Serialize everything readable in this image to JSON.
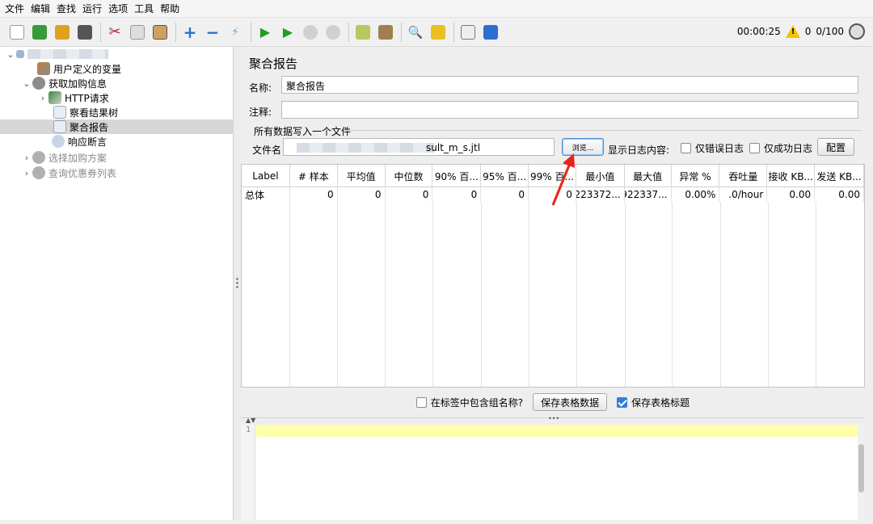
{
  "menu": [
    "文件",
    "编辑",
    "查找",
    "运行",
    "选项",
    "工具",
    "帮助"
  ],
  "toolbar": {
    "timer": "00:00:25",
    "warning_count": "0",
    "thread_count": "0/100",
    "icons": [
      "new-icon",
      "template-icon",
      "open-icon",
      "save-icon",
      "cut-icon",
      "copy-icon",
      "paste-icon",
      "add-icon",
      "remove-icon",
      "toggle-icon",
      "start-icon",
      "start-no-pause-icon",
      "stop-icon",
      "shutdown-icon",
      "clear-icon",
      "clear-all-icon",
      "search-icon",
      "reset-search-icon",
      "function-helper-icon",
      "help-icon"
    ]
  },
  "tree": {
    "items": [
      {
        "label": "",
        "level": 0,
        "expanded": true,
        "icon": "test-plan-icon",
        "redacted": true
      },
      {
        "label": "用户定义的变量",
        "level": 1,
        "icon": "variables-icon"
      },
      {
        "label": "获取加购信息",
        "level": 1,
        "expanded": true,
        "icon": "thread-group-icon"
      },
      {
        "label": "HTTP请求",
        "level": 2,
        "collapsed": true,
        "icon": "http-sampler-icon"
      },
      {
        "label": "察看结果树",
        "level": 2,
        "icon": "listener-icon"
      },
      {
        "label": "聚合报告",
        "level": 2,
        "icon": "listener-icon",
        "selected": true
      },
      {
        "label": "响应断言",
        "level": 2,
        "icon": "assertion-icon"
      },
      {
        "label": "选择加购方案",
        "level": 1,
        "collapsed": true,
        "disabled": true,
        "icon": "thread-group-icon"
      },
      {
        "label": "查询优惠券列表",
        "level": 1,
        "collapsed": true,
        "disabled": true,
        "icon": "thread-group-icon"
      }
    ]
  },
  "panel": {
    "title": "聚合报告",
    "name_label": "名称:",
    "name_value": "聚合报告",
    "comment_label": "注释:",
    "comment_value": "",
    "file_group": "所有数据写入一个文件",
    "filename_label": "文件名",
    "filename_value": "sult_m_s.jtl",
    "browse_button": "浏览...",
    "log_label": "显示日志内容:",
    "errors_only": "仅错误日志",
    "success_only": "仅成功日志",
    "configure_button": "配置"
  },
  "table": {
    "columns": [
      "Label",
      "# 样本",
      "平均值",
      "中位数",
      "90% 百...",
      "95% 百...",
      "99% 百...",
      "最小值",
      "最大值",
      "异常 %",
      "吞吐量",
      "接收 KB...",
      "发送 KB..."
    ],
    "rows": [
      [
        "总体",
        "0",
        "0",
        "0",
        "0",
        "0",
        "0",
        "9223372...",
        "-922337...",
        "0.00%",
        ".0/hour",
        "0.00",
        "0.00"
      ]
    ]
  },
  "bottom": {
    "include_group": "在标签中包含组名称?",
    "save_table_data": "保存表格数据",
    "save_table_header": "保存表格标题",
    "include_group_checked": false,
    "save_header_checked": true
  },
  "editor": {
    "line_numbers": [
      "1"
    ]
  },
  "colors": {
    "selected_row": "#d6d6d6",
    "editor_highlight": "#ffffaa",
    "arrow": "#e8231c",
    "checkbox_on": "#2f7fd8"
  }
}
